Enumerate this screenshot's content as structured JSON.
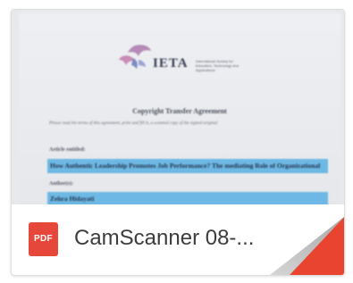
{
  "file": {
    "name": "CamScanner 08-...",
    "type_badge": "PDF",
    "icon": "pdf-file-icon",
    "badge_color": "#e5483b"
  },
  "thumbnail": {
    "logo_text": "IETA",
    "logo_subtitle": "International Society for Education, Technology and Applications",
    "title": "Copyright Transfer Agreement",
    "intro": "Please read the terms of this agreement, print and fill it, a scanned copy of the signed original",
    "article_label": "Article entitled:",
    "article_title": "How Authentic Leadership Promotes Job Performance? The mediating Role of Organizational",
    "author_label": "Author(s):",
    "author_name": "Zehra Hidayati",
    "highlight_color": "#6db8e4"
  },
  "corner_fold": {
    "icon": "page-fold-icon",
    "color": "#e8442f"
  }
}
